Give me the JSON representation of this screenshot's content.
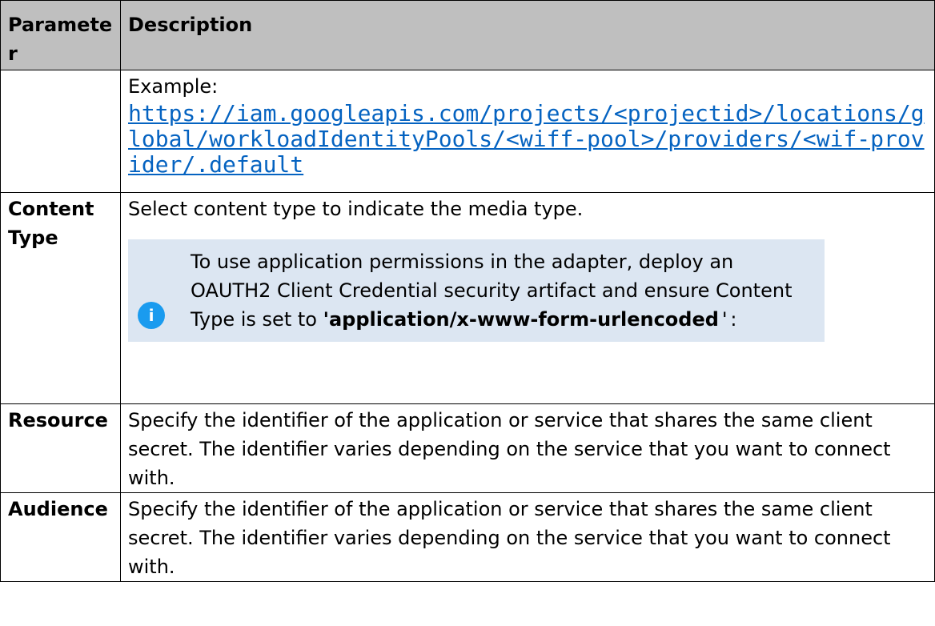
{
  "table": {
    "header": {
      "parameter": "Parameter",
      "description": "Description"
    },
    "rows": [
      {
        "parameter": "",
        "example_label": "Example:",
        "example_url": "https://iam.googleapis.com/projects/<projectid>/locations/global/workloadIdentityPools/<wiff-pool>/providers/<wif-provider/.default"
      },
      {
        "parameter": "Content Type",
        "description": "Select content type to indicate the media type.",
        "note": {
          "icon": "info-icon",
          "icon_glyph": "i",
          "text_before": "To use application permissions in the adapter, deploy an OAUTH2 Client Credential security artifact and ensure Content Type is set to ",
          "bold_value": "'application/x-www-form-urlencoded",
          "closing_quote": "'",
          "text_after": ":"
        }
      },
      {
        "parameter": "Resource",
        "description": "Specify the identifier of the application or service that shares the same client secret. The identifier varies depending on the service that you want to connect with."
      },
      {
        "parameter": "Audience",
        "description": "Specify the identifier of the application or service that shares the same client secret. The identifier varies depending on the service that you want to connect with."
      }
    ]
  },
  "colors": {
    "header_bg": "#bfbfbf",
    "note_bg": "#dce6f2",
    "info_icon": "#1a9bef",
    "link": "#0563c1"
  }
}
